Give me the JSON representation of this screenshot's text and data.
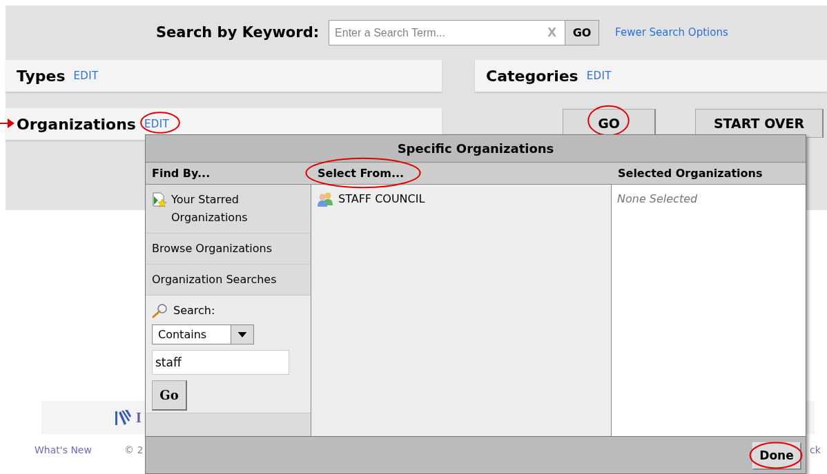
{
  "search": {
    "label": "Search by Keyword:",
    "placeholder": "Enter a Search Term...",
    "clear": "X",
    "go": "GO",
    "link": "Fewer Search Options"
  },
  "filters": [
    {
      "title": "Types",
      "edit": "EDIT",
      "highlighted": false,
      "pointer": false
    },
    {
      "title": "Categories",
      "edit": "EDIT",
      "highlighted": false,
      "pointer": false
    },
    {
      "title": "Organizations",
      "edit": "EDIT",
      "highlighted": true,
      "pointer": true
    }
  ],
  "actions": [
    {
      "label": "GO",
      "highlighted": true
    },
    {
      "label": "START OVER",
      "highlighted": false
    }
  ],
  "dialog": {
    "title": "Specific Organizations",
    "columns": [
      {
        "label": "Find By...",
        "highlighted": false
      },
      {
        "label": "Select From...",
        "highlighted": true
      },
      {
        "label": "Selected Organizations",
        "highlighted": false
      }
    ],
    "find_by": [
      {
        "label": "Your Starred Organizations",
        "kind": "starred"
      },
      {
        "label": "Browse Organizations",
        "kind": "plain"
      },
      {
        "label": "Organization Searches",
        "kind": "plain"
      }
    ],
    "search": {
      "label": "Search:",
      "match": "Contains",
      "value": "staff",
      "button": "Go"
    },
    "results": [
      {
        "name": "STAFF COUNCIL"
      }
    ],
    "selected_empty": "None Selected",
    "done": {
      "label": "Done",
      "highlighted": true
    }
  },
  "footer": {
    "logo_text": "I",
    "links": [
      "What's New",
      "© 2",
      "ck"
    ]
  }
}
